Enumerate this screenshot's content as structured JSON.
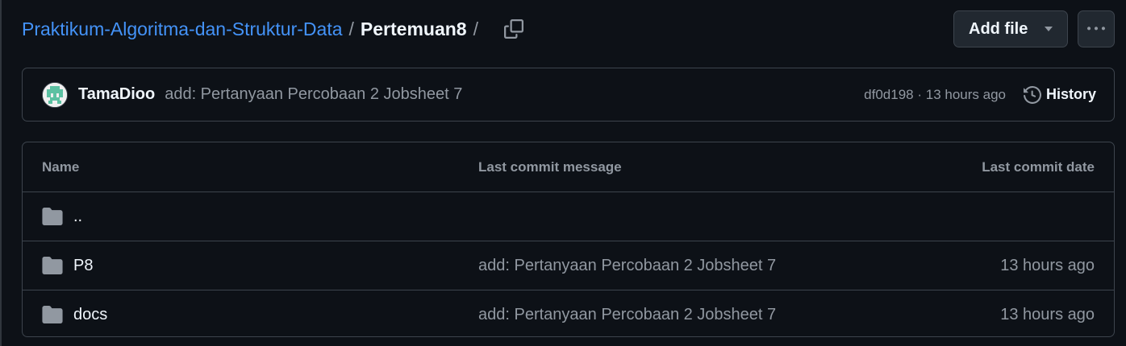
{
  "breadcrumb": {
    "repo": "Praktikum-Algoritma-dan-Struktur-Data",
    "separator": "/",
    "current": "Pertemuan8",
    "trailing_separator": "/"
  },
  "actions": {
    "add_file_label": "Add file",
    "more_label": "···"
  },
  "commit": {
    "author": "TamaDioo",
    "message": "add: Pertanyaan Percobaan 2 Jobsheet 7",
    "sha": "df0d198",
    "dot": " · ",
    "time": "13 hours ago",
    "history_label": "History"
  },
  "table": {
    "headers": {
      "name": "Name",
      "message": "Last commit message",
      "date": "Last commit date"
    },
    "rows": [
      {
        "name": "..",
        "message": "",
        "date": ""
      },
      {
        "name": "P8",
        "message": "add: Pertanyaan Percobaan 2 Jobsheet 7",
        "date": "13 hours ago"
      },
      {
        "name": "docs",
        "message": "add: Pertanyaan Percobaan 2 Jobsheet 7",
        "date": "13 hours ago"
      }
    ]
  },
  "icons": {
    "copy": "copy-icon",
    "caret": "triangle-down-icon",
    "more": "kebab-horizontal-icon",
    "history": "history-icon",
    "folder": "file-directory-icon"
  },
  "colors": {
    "background": "#0d1117",
    "link": "#4493f8",
    "muted": "#9198a1",
    "border": "#3d444d",
    "folder": "#9198a1"
  }
}
